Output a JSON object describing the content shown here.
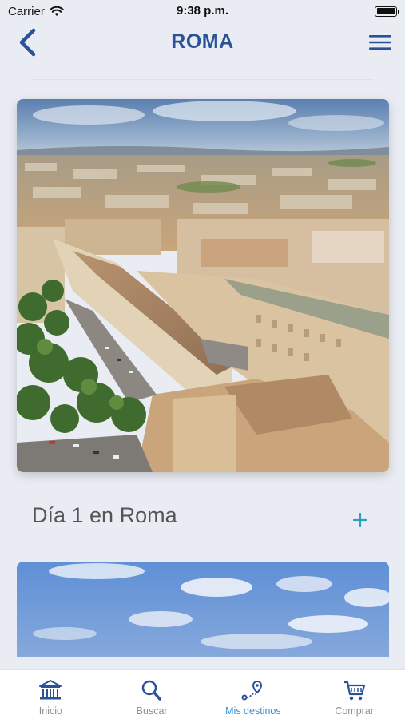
{
  "status_bar": {
    "carrier": "Carrier",
    "time": "9:38 p.m."
  },
  "nav": {
    "title": "ROMA"
  },
  "hero": {
    "icon": "vatican-aerial-photo"
  },
  "section": {
    "title": "Día 1 en Roma"
  },
  "tab_bar": {
    "items": [
      {
        "label": "Inicio",
        "icon": "museum-icon"
      },
      {
        "label": "Buscar",
        "icon": "search-icon"
      },
      {
        "label": "Mis destinos",
        "icon": "route-icon",
        "active": true
      },
      {
        "label": "Comprar",
        "icon": "cart-icon"
      }
    ]
  },
  "colors": {
    "accent": "#2a5298",
    "active_tab": "#3a8fd6",
    "add_icon": "#2fa0b8",
    "background": "#e9edf3"
  }
}
